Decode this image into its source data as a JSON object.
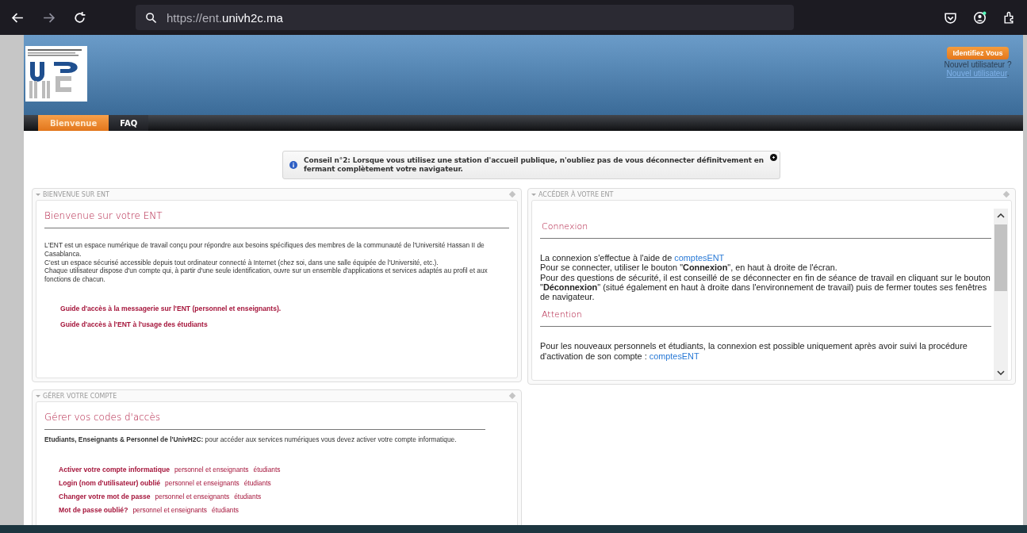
{
  "browser": {
    "url_scheme": "https://ent.",
    "url_domain": "univh2c.ma"
  },
  "header": {
    "login_button": "Identifiez Vous",
    "new_user_prompt": "Nouvel utilisateur ?",
    "new_user_link": "Nouvel utilisateur",
    "new_user_end": "."
  },
  "tabs": [
    {
      "label": "Bienvenue",
      "selected": true
    },
    {
      "label": "FAQ",
      "selected": false
    }
  ],
  "tip": {
    "text": "Conseil n°2: Lorsque vous utilisez une station d'accueil publique, n'oubliez pas de vous déconnecter définitvement en fermant complètement votre navigateur."
  },
  "welcome_panel": {
    "title": "BIENVENUE SUR ENT",
    "heading": "Bienvenue sur votre ENT",
    "lines": [
      "L'ENT est un espace numérique de travail conçu pour répondre aux besoins spécifiques des membres de la communauté de l'Université Hassan II de Casablanca.",
      "C'est un espace sécurisé accessible depuis tout ordinateur connecté à Internet (chez soi, dans une salle équipée de l'Université, etc.).",
      "Chaque utilisateur dispose d'un compte qui, à partir d'une seule identification, ouvre sur un ensemble d'applications et services adaptés au profil et aux fonctions de chacun."
    ],
    "links": [
      "Guide d'accès à la messagerie sur l'ENT (personnel et enseignants).",
      "Guide d'accès à l'ENT à l'usage des étudiants"
    ]
  },
  "access_panel": {
    "title": "ACCÉDER À VOTRE ENT",
    "sections": [
      {
        "heading": "Connexion",
        "lead": "La connexion s'effectue à l'aide de ",
        "lead_link": "comptesENT",
        "paragraphs": [
          "Pour se connecter, utiliser le bouton \"**Connexion**\", en haut à droite de l'écran.",
          "Pour des questions de sécurité, il est conseillé de se déconnecter en fin de séance de travail en cliquant sur le bouton \"**Déconnexion**\" (situé également en haut à droite dans l'environnement de travail) puis de fermer toutes ses fenêtres de navigateur."
        ]
      },
      {
        "heading": "Attention",
        "lead": "Pour les nouveaux personnels et étudiants, la connexion est possible uniquement après avoir suivi la procédure d'activation de son compte : ",
        "lead_link": "comptesENT"
      }
    ]
  },
  "account_panel": {
    "title": "GÉRER VOTRE COMPTE",
    "heading": "Gérer vos codes d'accès",
    "intro": "**Etudiants, Enseignants & Personnel de l'UnivH2C:** pour accéder aux services numériques vous devez activer votre compte informatique.",
    "items": [
      {
        "label": "Activer votre compte informatique",
        "links": [
          "personnel et enseignants",
          "étudiants"
        ]
      },
      {
        "label": "Login (nom d'utilisateur) oublié",
        "links": [
          "personnel et enseignants",
          "étudiants"
        ]
      },
      {
        "label": "Changer votre mot de passe",
        "links": [
          "personnel et enseignants",
          "étudiants"
        ]
      },
      {
        "label": "Mot de passe oublié?",
        "links": [
          "personnel et enseignants",
          "étudiants"
        ]
      }
    ]
  }
}
